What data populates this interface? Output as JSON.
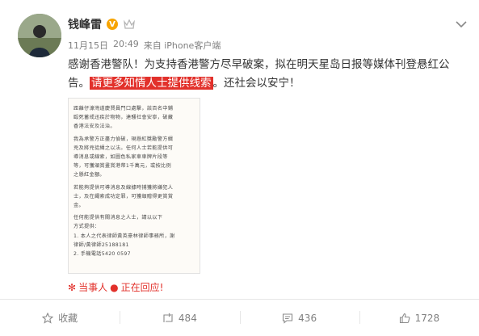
{
  "post": {
    "username": "钱峰雷",
    "verified_badge": "V",
    "date": "11月15日",
    "time": "20:49",
    "source": "来自 iPhone客户端",
    "text_before": "感谢香港警队！为支持香港警方尽早破案，拟在明天星岛日报等媒体刊登悬红公告。",
    "text_highlight": "请更多知情人士提供线索",
    "text_after": "。还社会以安宁！"
  },
  "document_lines": [
    "距離仔濠灣道慶賢員門口處擊，該百名中鋪",
    "毆死蓄戒迅疾於物物，達騷社會安寧，破藏",
    "香港法安及法治。",
    "",
    "我為承警方正盡力偵破，現懸紅獎勵警方緝",
    "兇及將兇徒緝之以法。任何人士若能提供可",
    "導消息或線索，如圖色私家車車牌片段等",
    "等，可獲頒賞畫賞港幣1千萬元，或按比例",
    "之懸紅金額。",
    "",
    "若能夠提供可導消息及線據時捕獲將嫌犯人",
    "士，及在繩索成功定罪，可獲頒贈得更賞賞",
    "金。",
    "",
    "  任何能提供有關消息之人士，請以以下",
    "方式提供：",
    "1. 本人之代表律師黃英豪林律師事務所，謝",
    "律師/黃律師25188181",
    "2. 手機電話5420 0597"
  ],
  "tag": {
    "prefix": "当事人",
    "suffix": "正在回应!"
  },
  "actions": {
    "favorite": "收藏",
    "repost": "484",
    "comment": "436",
    "like": "1728"
  },
  "colors": {
    "highlight": "#e2312b",
    "verified": "#f7a400",
    "muted": "#808080"
  }
}
